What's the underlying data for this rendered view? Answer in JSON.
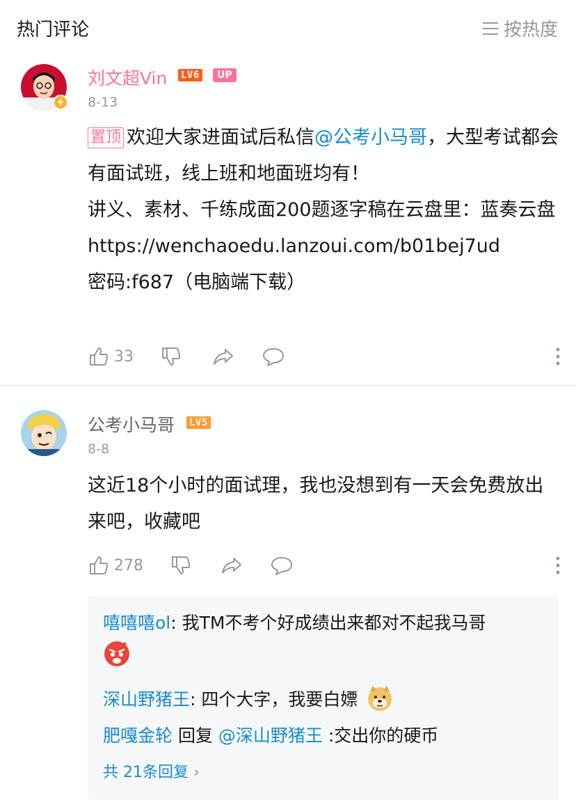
{
  "header": {
    "title": "热门评论",
    "sort_label": "按热度"
  },
  "comments": [
    {
      "username": "刘文超Vin",
      "level": "LV6",
      "up_badge": "UP",
      "date": "8-13",
      "pin_label": "置顶",
      "text_1": "欢迎大家进面试后私信",
      "mention": "@公考小马哥",
      "text_2": "，大型考试都会有面试班，线上班和地面班均有！",
      "line_3": "讲义、素材、千练成面200题逐字稿在云盘里：蓝奏云盘",
      "line_4": "https://wenchaoedu.lanzoui.com/b01bej7ud",
      "line_5": "密码:f687（电脑端下载）",
      "likes": "33"
    },
    {
      "username": "公考小马哥",
      "level": "LV5",
      "date": "8-8",
      "text": "这近18个小时的面试理，我也没想到有一天会免费放出来吧，收藏吧",
      "likes": "278",
      "replies": [
        {
          "name": "嘻嘻嘻ol",
          "text": ": 我TM不考个好成绩出来都对不起我马哥"
        },
        {
          "name": "深山野猪王",
          "text": ": 四个大字，我要白嫖"
        },
        {
          "name": "肥嘎金轮",
          "mid": " 回复 ",
          "mention": "@深山野猪王",
          "text": " :交出你的硬币"
        }
      ],
      "more_replies": "共 21条回复"
    }
  ],
  "colors": {
    "accent_pink": "#fb7299",
    "link_blue": "#178bcf",
    "muted_gray": "#9499a0"
  }
}
